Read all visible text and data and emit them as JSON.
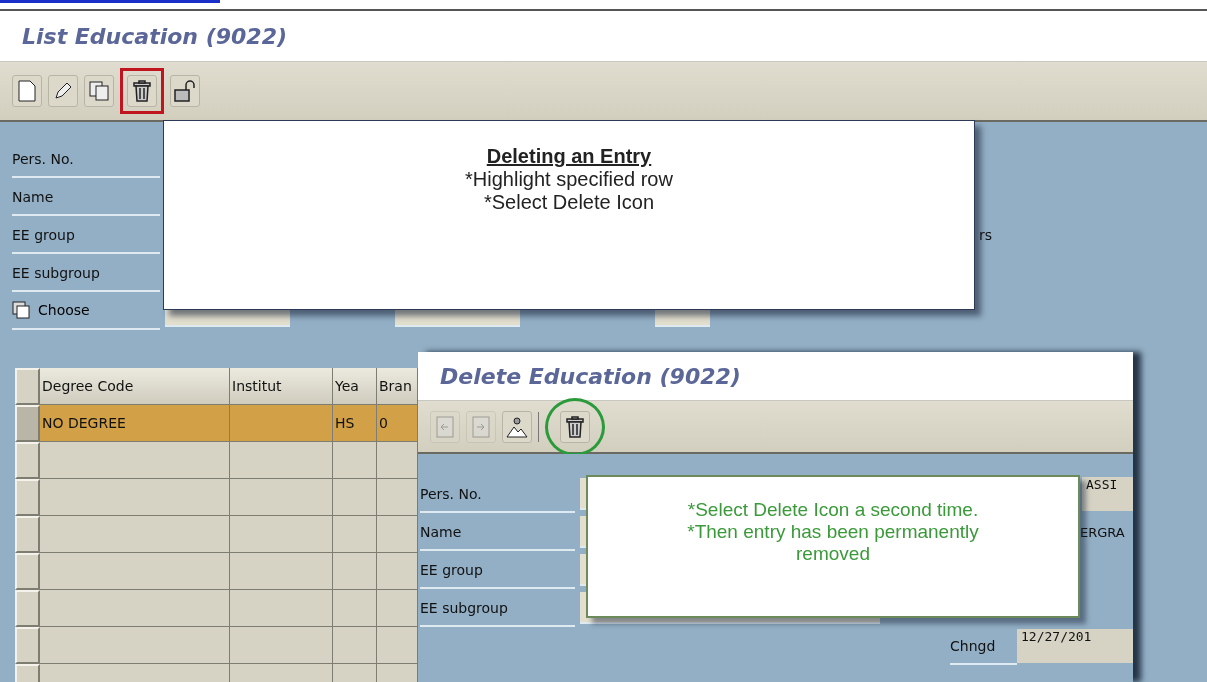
{
  "main_window": {
    "title": "List Education (9022)",
    "toolbar": [
      {
        "kind": "new",
        "marked": false
      },
      {
        "kind": "edit",
        "marked": false
      },
      {
        "kind": "copy",
        "marked": false
      },
      {
        "kind": "delete",
        "marked": true
      },
      {
        "kind": "lock",
        "marked": false
      }
    ],
    "form": [
      {
        "label": "Pers. No."
      },
      {
        "label": "Name"
      },
      {
        "label": "EE group",
        "trailing": "rs"
      },
      {
        "label": "EE subgroup"
      }
    ],
    "period": {
      "label": "Choose"
    },
    "table": {
      "columns": [
        "Degree Code",
        "Institut",
        "Yea",
        "Bran"
      ],
      "rows": [
        {
          "selected": true,
          "cells": [
            "NO DEGREE",
            null,
            "HS",
            "0"
          ]
        },
        {
          "selected": false
        },
        {
          "selected": false
        },
        {
          "selected": false
        },
        {
          "selected": false
        },
        {
          "selected": false
        },
        {
          "selected": false
        },
        {
          "selected": false
        }
      ]
    }
  },
  "popup_window": {
    "title": "Delete Education (9022)",
    "toolbar": [
      {
        "kind": "previous",
        "disabled": true,
        "marked": false
      },
      {
        "kind": "next",
        "disabled": true,
        "marked": false
      },
      {
        "kind": "picture",
        "disabled": false,
        "marked": false
      },
      {
        "kind": "delete",
        "disabled": false,
        "marked": true
      }
    ],
    "form": [
      {
        "label": "Pers. No.",
        "value": "ASSI",
        "kind": "field"
      },
      {
        "label": "Name",
        "value": "ERGRA",
        "kind": "text"
      },
      {
        "label": "EE group"
      },
      {
        "label": "EE subgroup"
      }
    ],
    "changed": {
      "label": "Chngd",
      "value": "12/27/201"
    }
  },
  "callouts": [
    {
      "kind": "plain",
      "title": "Deleting an Entry",
      "lines": [
        "*Highlight specified row",
        "*Select Delete Icon"
      ]
    },
    {
      "kind": "green",
      "lines": [
        "*Select Delete Icon a second time.",
        "*Then entry has been permanently removed"
      ]
    }
  ]
}
